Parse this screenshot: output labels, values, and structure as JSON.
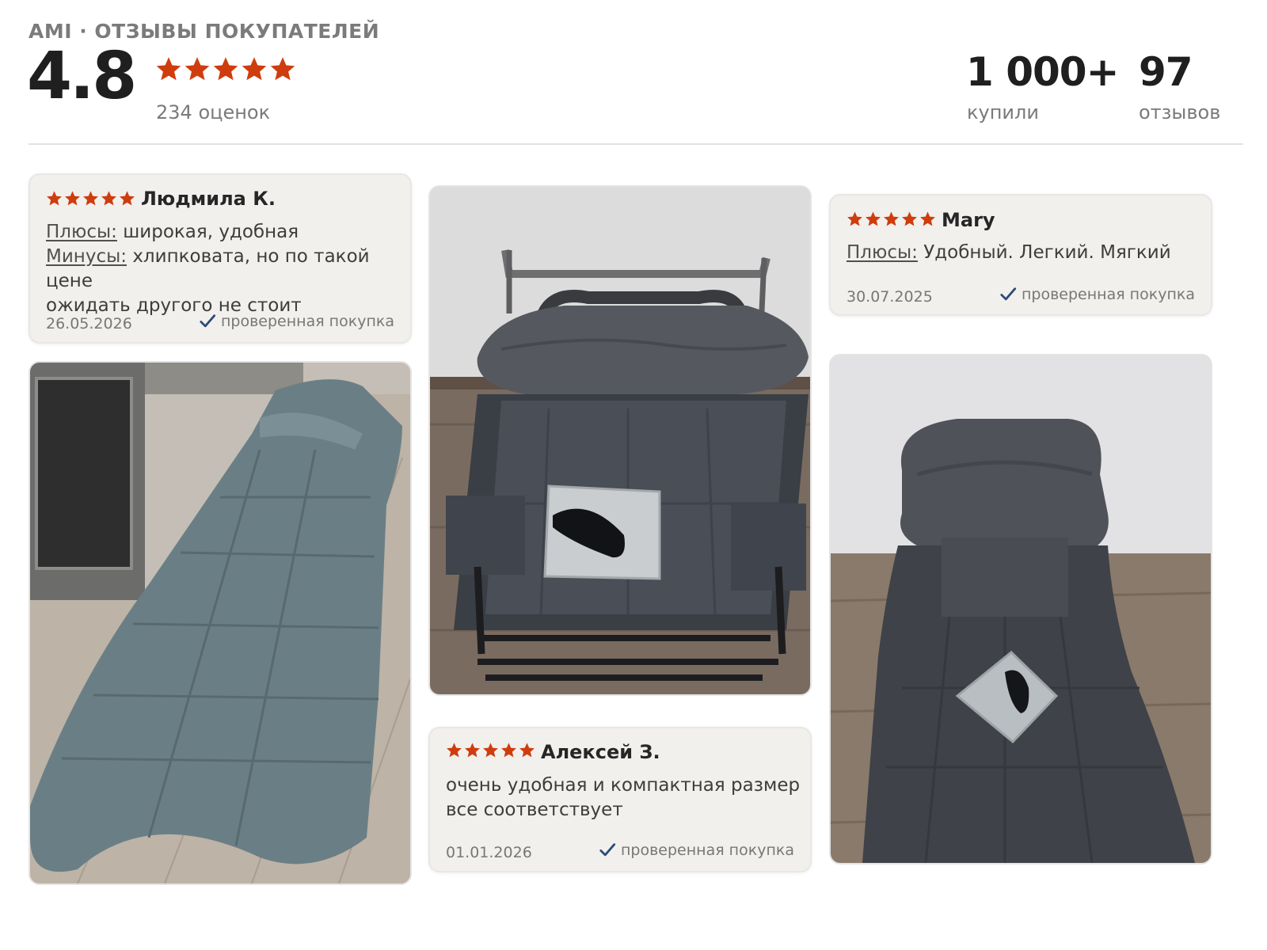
{
  "header": {
    "brand": "AMI · ОТЗЫВЫ ПОКУПАТЕЛЕЙ",
    "rating": "4.8",
    "stars": 5,
    "ratings_count": "234 оценок",
    "stats": [
      {
        "value": "1 000+",
        "label": "купили"
      },
      {
        "value": "97",
        "label": "отзывов"
      }
    ]
  },
  "reviews": [
    {
      "stars": 5,
      "name": "Людмила К.",
      "pros_label": "Плюсы:",
      "pros": "широкая, удобная",
      "cons_label": "Минусы:",
      "cons": "хлипковата, но по такой цене",
      "cons_line2": "ожидать другого не стоит",
      "date": "26.05.2026",
      "verified": "проверенная покупка"
    },
    {
      "stars": 5,
      "name": "Mary",
      "pros_label": "Плюсы:",
      "pros": "Удобный. Легкий. Мягкий",
      "date": "30.07.2025",
      "verified": "проверенная покупка"
    },
    {
      "stars": 5,
      "name": "Алексей З.",
      "text_line1": "очень удобная и компактная размер",
      "text_line2": "все соответствует",
      "date": "01.01.2026",
      "verified": "проверенная покупка"
    }
  ],
  "photos": [
    {
      "subject": "folding cot on wooden floor"
    },
    {
      "subject": "folded cot with pillow and eye mask"
    },
    {
      "subject": "cot with headrest and eye mask"
    }
  ],
  "colors": {
    "star": "#cf3d0e",
    "verified_check": "#2b4a78",
    "card_bg": "#f1f0ed",
    "muted_text": "#7a7a7a"
  }
}
